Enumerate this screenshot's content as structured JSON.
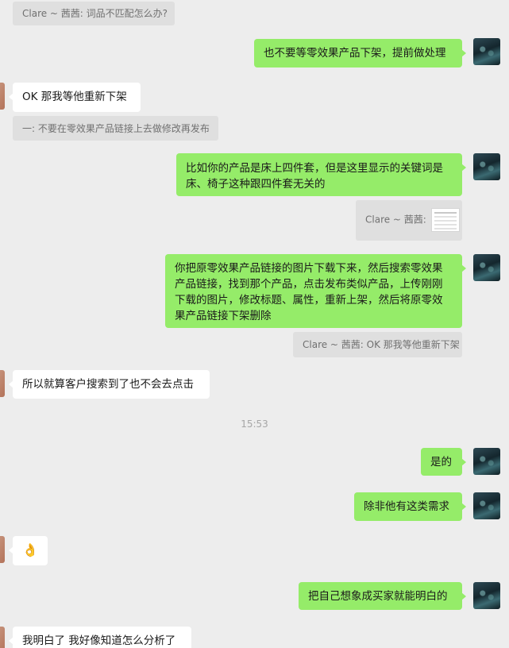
{
  "messages": {
    "m1_quote": "Clare ~ 茜茜: 词品不匹配怎么办?",
    "m2": "也不要等零效果产品下架，提前做处理",
    "m3": "OK 那我等他重新下架",
    "m3_quote": "一: 不要在零效果产品链接上去做修改再发布",
    "m4": "比如你的产品是床上四件套，但是这里显示的关键词是床、椅子这种跟四件套无关的",
    "m4_quote": "Clare ~ 茜茜:",
    "m5": "你把原零效果产品链接的图片下载下来，然后搜索零效果产品链接，找到那个产品，点击发布类似产品，上传刚刚下载的图片，修改标题、属性，重新上架，然后将原零效果产品链接下架删除",
    "m5_quote": "Clare ~ 茜茜: OK 那我等他重新下架",
    "m6": "所以就算客户搜索到了也不会去点击",
    "time": "15:53",
    "m7": "是的",
    "m8": "除非他有这类需求",
    "m9": "👌",
    "m10": "把自己想象成买家就能明白的",
    "m11": "我明白了 我好像知道怎么分析了"
  }
}
